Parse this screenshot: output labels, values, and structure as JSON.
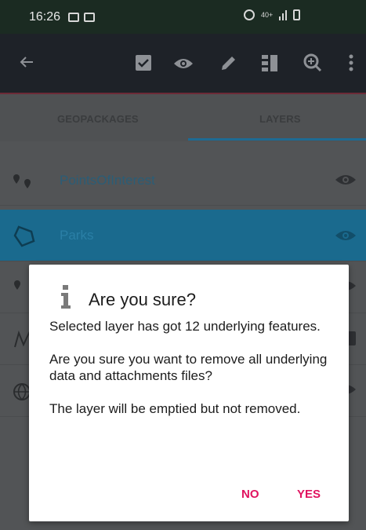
{
  "status_bar": {
    "time": "16:26",
    "network_label": "40+"
  },
  "toolbar": {
    "icons": [
      "back-arrow-icon",
      "checkbox-icon",
      "eye-icon",
      "pencil-icon",
      "list-view-icon",
      "zoom-in-icon",
      "more-vert-icon"
    ]
  },
  "tabs": [
    {
      "label": "GEOPACKAGES"
    },
    {
      "label": "LAYERS"
    }
  ],
  "layers": [
    {
      "name": "PointsOfInterest",
      "type_icon": "points-icon",
      "visible": true,
      "selected": false
    },
    {
      "name": "Parks",
      "type_icon": "polygon-icon",
      "visible": true,
      "selected": true
    }
  ],
  "dialog": {
    "title": "Are you sure?",
    "message_1": "Selected layer has got 12 underlying features.",
    "message_2": "Are you sure you want to remove all underlying data and attachments files?",
    "message_3": "The layer will be emptied but not removed.",
    "no_label": "NO",
    "yes_label": "YES"
  },
  "colors": {
    "accent": "#e0135f",
    "selected_row": "#1a6a8e",
    "tab_indicator": "#1e6b93"
  }
}
